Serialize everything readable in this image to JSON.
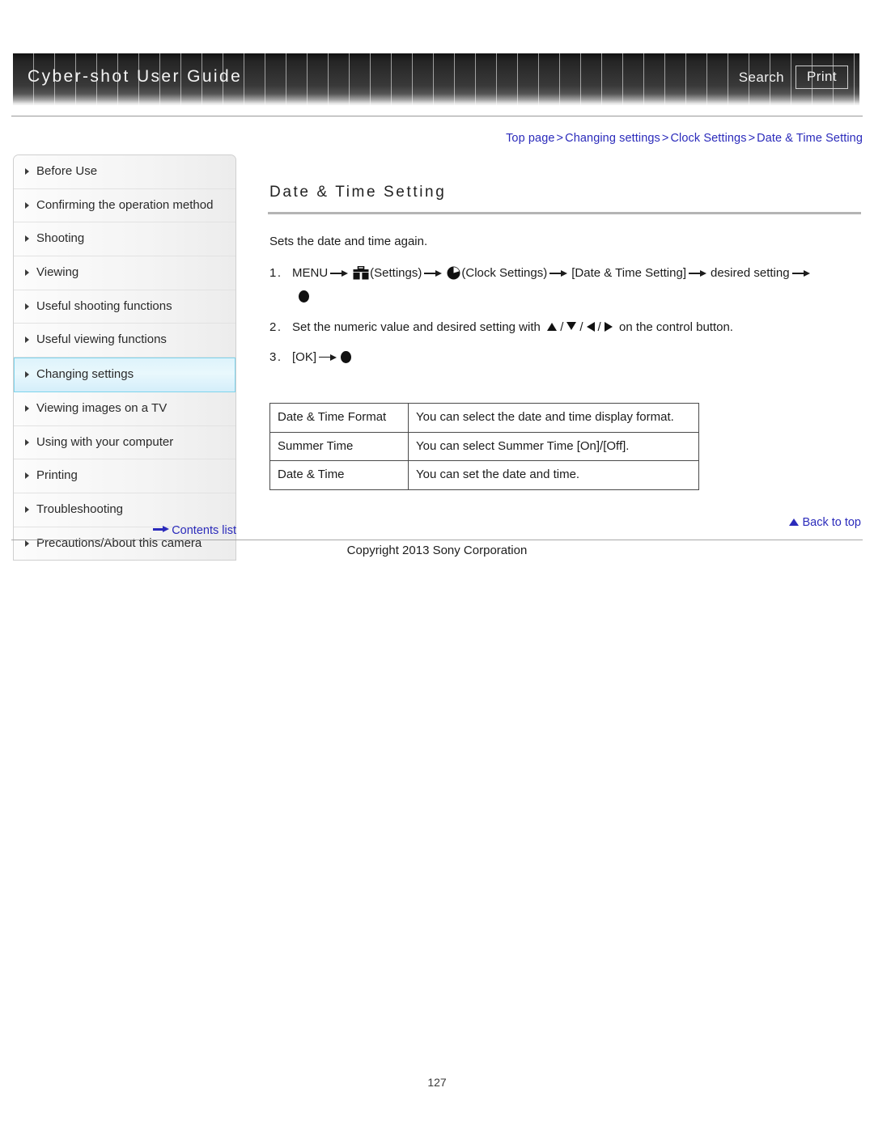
{
  "header": {
    "title": "Cyber-shot User Guide",
    "search_label": "Search",
    "print_label": "Print"
  },
  "breadcrumb": {
    "items": [
      "Top page",
      "Changing settings",
      "Clock Settings",
      "Date & Time Setting"
    ],
    "separator": ">"
  },
  "sidebar": {
    "items": [
      {
        "label": "Before Use",
        "active": false
      },
      {
        "label": "Confirming the operation method",
        "active": false
      },
      {
        "label": "Shooting",
        "active": false
      },
      {
        "label": "Viewing",
        "active": false
      },
      {
        "label": "Useful shooting functions",
        "active": false
      },
      {
        "label": "Useful viewing functions",
        "active": false
      },
      {
        "label": "Changing settings",
        "active": true
      },
      {
        "label": "Viewing images on a TV",
        "active": false
      },
      {
        "label": "Using with your computer",
        "active": false
      },
      {
        "label": "Printing",
        "active": false
      },
      {
        "label": "Troubleshooting",
        "active": false
      },
      {
        "label": "Precautions/About this camera",
        "active": false
      }
    ],
    "contents_list_label": "Contents list"
  },
  "main": {
    "title": "Date & Time Setting",
    "intro": "Sets the date and time again.",
    "steps": [
      {
        "num": "1.",
        "parts": [
          {
            "type": "text",
            "value": "MENU"
          },
          {
            "type": "arrow"
          },
          {
            "type": "icon",
            "name": "toolbox-icon"
          },
          {
            "type": "text",
            "value": "(Settings)"
          },
          {
            "type": "arrow"
          },
          {
            "type": "icon",
            "name": "clock-icon"
          },
          {
            "type": "text",
            "value": "(Clock Settings)"
          },
          {
            "type": "arrow"
          },
          {
            "type": "text",
            "value": "[Date & Time Setting]"
          },
          {
            "type": "arrow"
          },
          {
            "type": "text",
            "value": "desired setting"
          },
          {
            "type": "arrow"
          },
          {
            "type": "icon",
            "name": "center-button-icon"
          }
        ]
      },
      {
        "num": "2.",
        "text_before": "Set the numeric value and desired setting with",
        "text_after": "on the control button."
      },
      {
        "num": "3.",
        "text_before": "[OK]"
      }
    ],
    "table": {
      "rows": [
        {
          "key": "Date & Time Format",
          "value": "You can select the date and time display format."
        },
        {
          "key": "Summer Time",
          "value": "You can select Summer Time [On]/[Off]."
        },
        {
          "key": "Date & Time",
          "value": "You can set the date and time."
        }
      ]
    },
    "back_to_top_label": "Back to top"
  },
  "footer": {
    "copyright": "Copyright 2013 Sony Corporation",
    "page_number": "127"
  },
  "colors": {
    "link": "#2b2bbb",
    "active_nav_border": "#7ed4ec",
    "banner_dark": "#242424"
  }
}
